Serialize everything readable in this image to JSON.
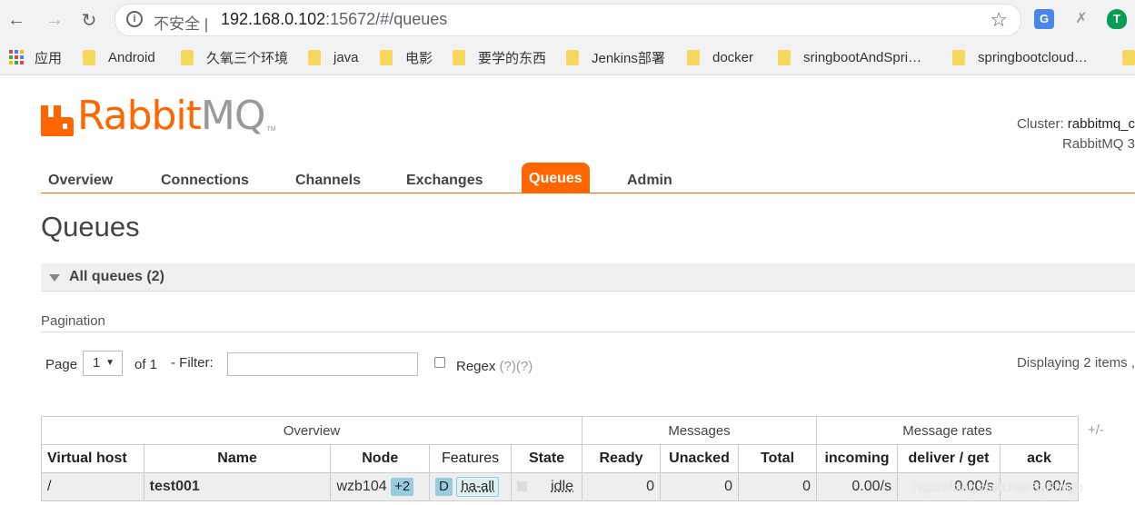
{
  "browser": {
    "insecure_label": "不安全 |",
    "url_host": "192.168.0.102",
    "url_rest": ":15672/#/queues",
    "bookmarks": {
      "apps": "应用",
      "items": [
        "Android",
        "久氧三个环境",
        "java",
        "电影",
        "要学的东西",
        "Jenkins部署",
        "docker",
        "sringbootAndSpri…",
        "springbootcloud…"
      ]
    }
  },
  "header": {
    "logo_rabbit": "Rabbit",
    "logo_mq": "MQ",
    "logo_tm": "TM",
    "cluster_label": "Cluster:",
    "cluster_value": "rabbitmq_c",
    "version": "RabbitMQ 3"
  },
  "tabs": [
    "Overview",
    "Connections",
    "Channels",
    "Exchanges",
    "Queues",
    "Admin"
  ],
  "active_tab": "Queues",
  "page_title": "Queues",
  "section": {
    "label": "All queues (2)"
  },
  "pagination": {
    "heading": "Pagination",
    "page_label": "Page",
    "page_value": "1",
    "of_label": "of 1",
    "filter_label": "- Filter:",
    "filter_value": "",
    "regex_label": "Regex",
    "regex_help": "(?)(?)",
    "displaying": "Displaying 2 items ,"
  },
  "table": {
    "groups": [
      "Overview",
      "Messages",
      "Message rates"
    ],
    "plusminus": "+/-",
    "columns": [
      "Virtual host",
      "Name",
      "Node",
      "Features",
      "State",
      "Ready",
      "Unacked",
      "Total",
      "incoming",
      "deliver / get",
      "ack"
    ],
    "rows": [
      {
        "vhost": "/",
        "name": "test001",
        "node": "wzb104",
        "node_badge": "+2",
        "feature_d": "D",
        "feature_ha": "ha-all",
        "state": "idle",
        "ready": "0",
        "unacked": "0",
        "total": "0",
        "incoming": "0.00/s",
        "deliver_get": "0.00/s",
        "ack": "0.00/s"
      }
    ]
  },
  "watermark": "https://blog.csdn.net/SyRango"
}
